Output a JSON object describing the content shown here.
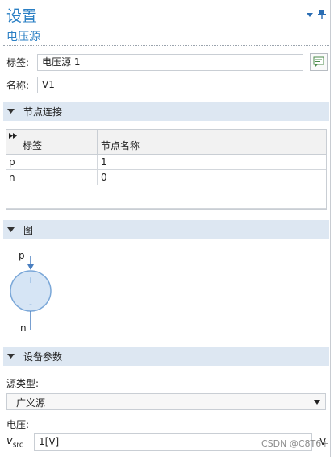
{
  "header": {
    "title": "设置",
    "subtitle": "电压源"
  },
  "fields": {
    "tag_label": "标签:",
    "tag_value": "电压源 1",
    "name_label": "名称:",
    "name_value": "V1"
  },
  "sections": {
    "node_connect": "节点连接",
    "figure": "图",
    "device_params": "设备参数"
  },
  "table": {
    "headers": [
      "标签",
      "节点名称"
    ],
    "rows": [
      {
        "tag": "p",
        "node": "1"
      },
      {
        "tag": "n",
        "node": "0"
      }
    ]
  },
  "diagram": {
    "top_label": "p",
    "bottom_label": "n",
    "plus": "+",
    "minus": "-"
  },
  "params": {
    "source_type_label": "源类型:",
    "source_type_value": "广义源",
    "voltage_label": "电压:",
    "vsrc_symbol": "v",
    "vsrc_sub": "src",
    "vsrc_value": "1[V]",
    "unit": "V"
  },
  "watermark": "CSDN @C8T6+",
  "icons": {
    "dropdown": "chevron-down-icon",
    "pin": "pin-icon",
    "note": "note-icon",
    "collapse": "collapse-triangle-icon",
    "fast_forward": "fast-forward-icon"
  },
  "colors": {
    "title_blue": "#2a7fc4",
    "section_bg": "#dde7f2",
    "diagram_blue": "#7aa7d8"
  }
}
